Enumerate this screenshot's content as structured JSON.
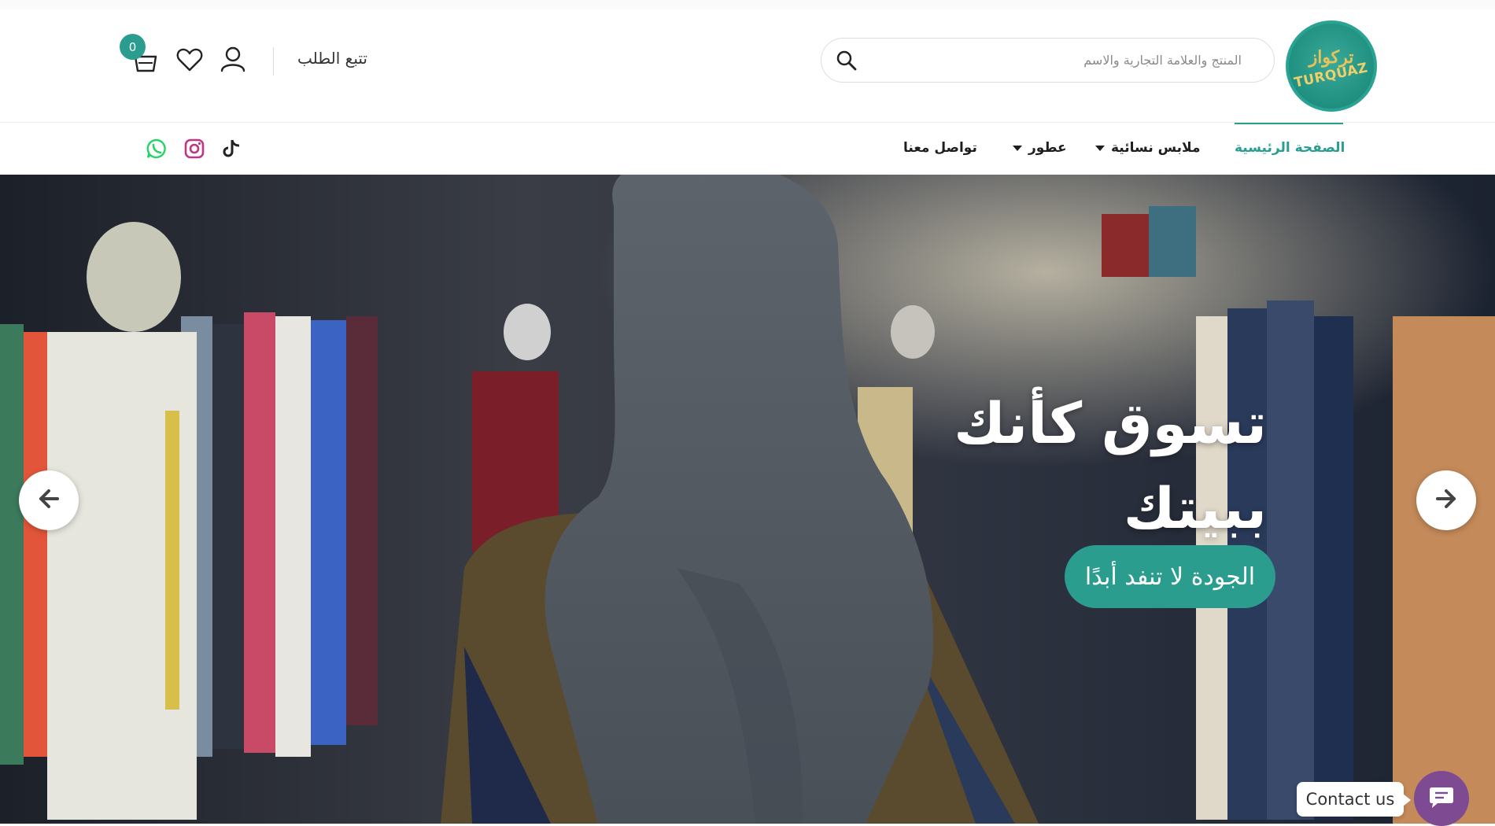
{
  "brand": {
    "logo_arabic": "تركواز",
    "logo_latin": "TURQUAZ"
  },
  "header": {
    "search_placeholder": "المنتج والعلامة التجارية والاسم",
    "track_order_label": "تتبع الطلب",
    "cart_count": "0"
  },
  "nav": {
    "items": [
      {
        "label": "الصفحة الرئيسية",
        "active": true
      },
      {
        "label": "ملابس نسائية",
        "dropdown": true
      },
      {
        "label": "عطور",
        "dropdown": true
      },
      {
        "label": "تواصل معنا"
      }
    ]
  },
  "social": [
    "tiktok-icon",
    "instagram-icon",
    "whatsapp-icon"
  ],
  "hero": {
    "title_line1": "تسوق كأنك",
    "title_line2": "ببيتك",
    "cta_label": "الجودة لا تنفد أبدًا"
  },
  "contact_widget": {
    "label": "Contact us"
  },
  "colors": {
    "accent": "#2a9d8f",
    "contact_button": "#7e4a91",
    "instagram": "#c13584",
    "whatsapp": "#25d366"
  }
}
